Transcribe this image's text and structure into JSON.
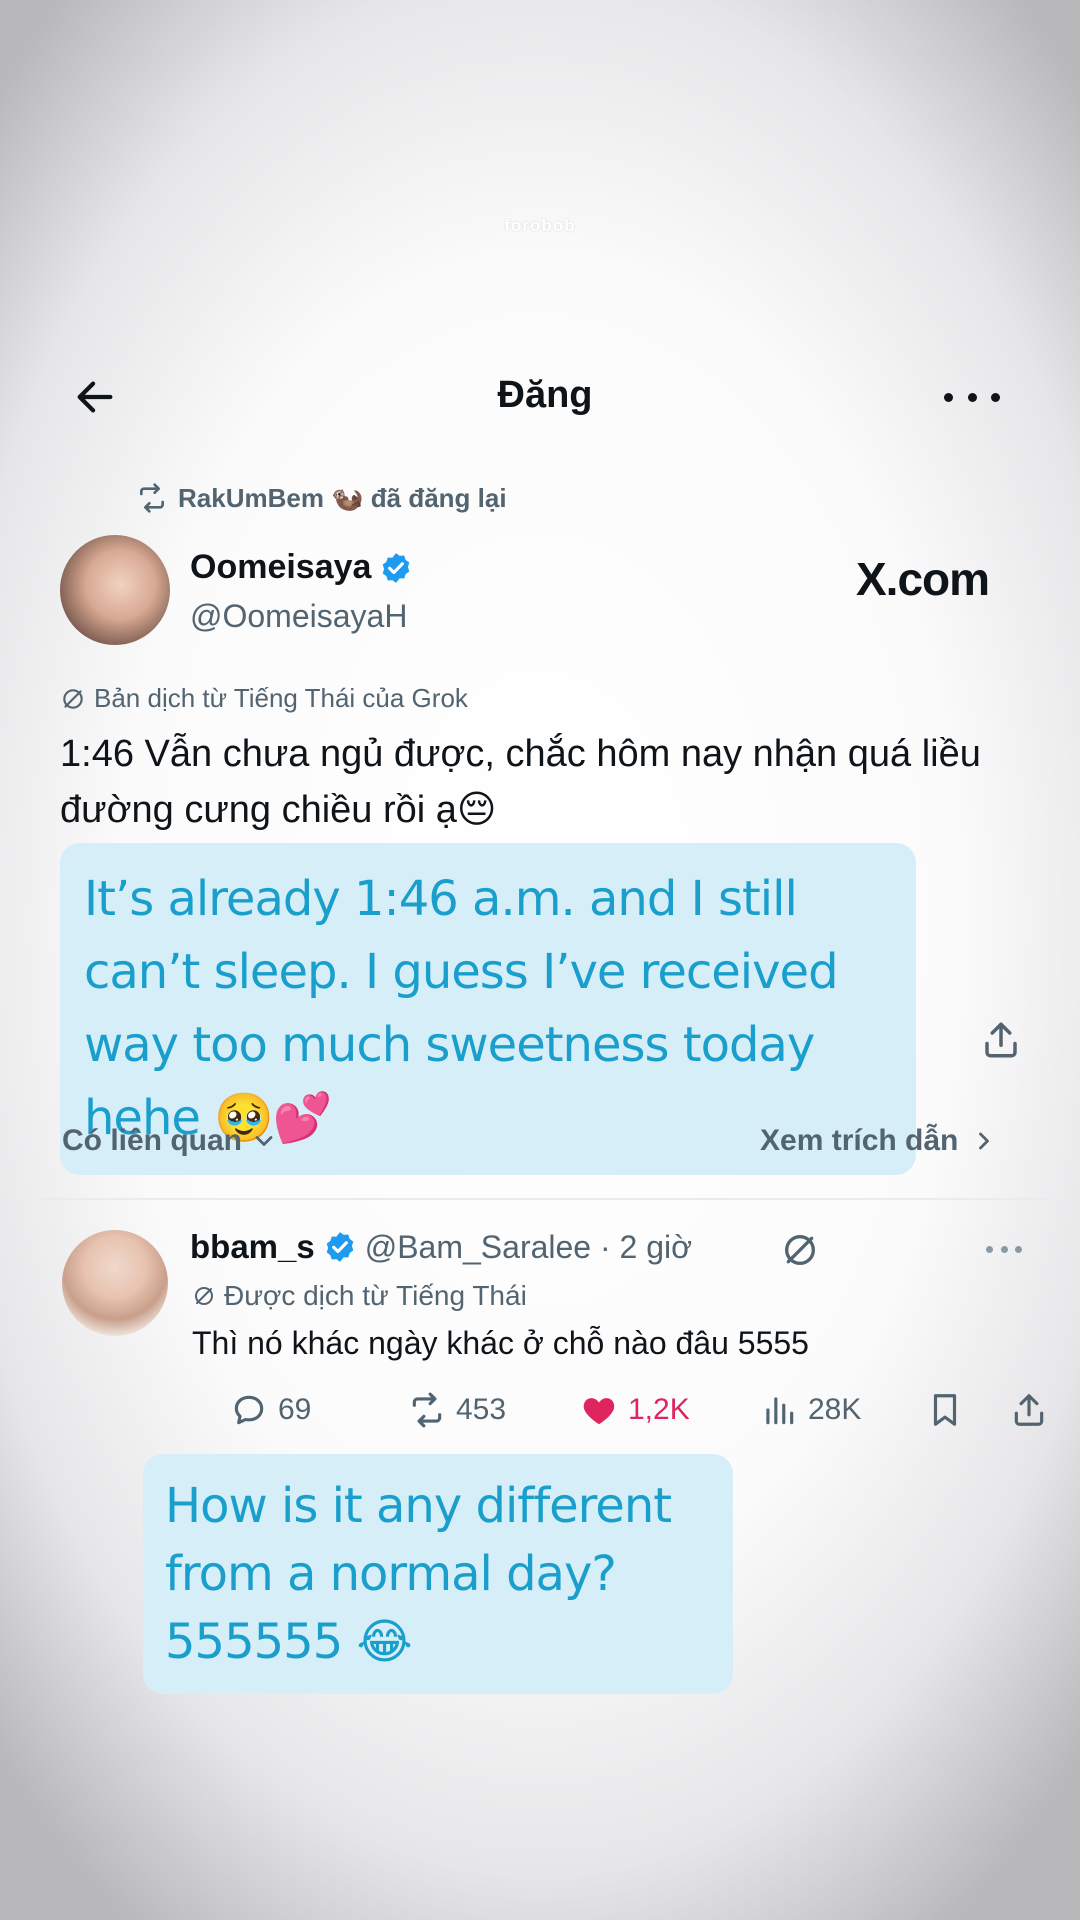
{
  "watermark": "forobob",
  "header": {
    "title": "Đăng"
  },
  "repost": {
    "text": "RakUmBem 🦦 đã đăng lại"
  },
  "post": {
    "display_name": "Oomeisaya",
    "handle": "@OomeisayaH",
    "source_label": "X.com",
    "translation_note": "Bản dịch từ Tiếng Thái của Grok",
    "text": "1:46 Vẫn chưa ngủ được, chắc hôm nay nhận quá liều đường cưng chiều rồi ạ😔",
    "overlay_translation": "It’s already 1:46 a.m. and I still can’t sleep. I guess I’ve received way too much sweetness today hehe 🥹💕",
    "related_label": "Có liên quan",
    "quotes_label": "Xem trích dẫn"
  },
  "reply": {
    "display_name": "bbam_s",
    "meta": "@Bam_Saralee · 2 giờ",
    "translation_note": "Được dịch từ Tiếng Thái",
    "text": "Thì nó khác ngày khác ở chỗ nào đâu 5555",
    "stats": {
      "replies": "69",
      "reposts": "453",
      "likes": "1,2K",
      "views": "28K"
    },
    "overlay_translation": "How is it any different from a normal day? 555555 😂"
  },
  "colors": {
    "accent": "#1d9bf0",
    "like": "#e0245e",
    "overlay_bg": "#d6eef7",
    "overlay_text": "#1a9fcc"
  },
  "icons": [
    "back-arrow-icon",
    "more-icon",
    "repost-icon",
    "verified-icon",
    "grok-translate-icon",
    "share-icon",
    "chevron-down-icon",
    "chevron-right-icon",
    "reply-icon",
    "heart-icon",
    "views-icon",
    "bookmark-icon"
  ]
}
